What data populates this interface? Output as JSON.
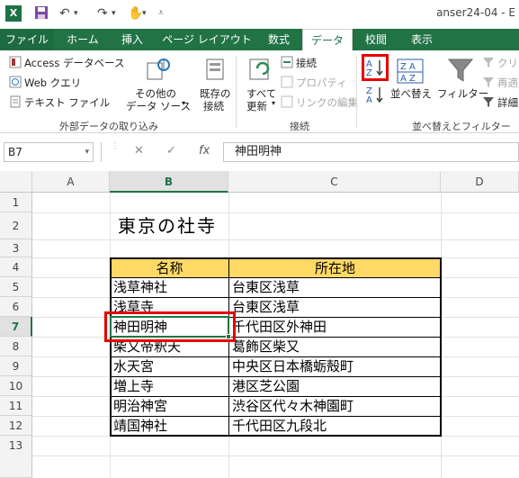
{
  "window": {
    "app_icon": "X",
    "title": "anser24-04 - E"
  },
  "ribbon_tabs": [
    "ファイル",
    "ホーム",
    "挿入",
    "ページ レイアウト",
    "数式",
    "データ",
    "校閲",
    "表示"
  ],
  "ribbon": {
    "external": {
      "access": "Access データベース",
      "web": "Web クエリ",
      "text": "テキスト ファイル",
      "other_line1": "その他の",
      "other_line2": "データ ソース",
      "existing_line1": "既存の",
      "existing_line2": "接続",
      "group_label": "外部データの取り込み"
    },
    "connections": {
      "refresh_line1": "すべて",
      "refresh_line2": "更新",
      "connections": "接続",
      "properties": "プロパティ",
      "edit_links": "リンクの編集",
      "group_label": "接続"
    },
    "sort_filter": {
      "sort_label": "並べ替え",
      "filter_label": "フィルター",
      "clear": "クリア",
      "reapply": "再適",
      "advanced": "詳細",
      "group_label": "並べ替えとフィルター"
    }
  },
  "formula_bar": {
    "name_box": "B7",
    "fx": "fx",
    "cancel": "✕",
    "enter": "✓",
    "formula": "神田明神"
  },
  "sheet": {
    "columns": [
      "A",
      "B",
      "C",
      "D"
    ],
    "rows": [
      "1",
      "2",
      "3",
      "4",
      "5",
      "6",
      "7",
      "8",
      "9",
      "10",
      "11",
      "12",
      "13"
    ],
    "title": "東京の社寺",
    "table_headers": [
      "名称",
      "所在地"
    ],
    "table_rows": [
      [
        "浅草神社",
        "台東区浅草"
      ],
      [
        "浅草寺",
        "台東区浅草"
      ],
      [
        "神田明神",
        "千代田区外神田"
      ],
      [
        "柴又帝釈天",
        "葛飾区柴又"
      ],
      [
        "水天宮",
        "中央区日本橋蛎殻町"
      ],
      [
        "増上寺",
        "港区芝公園"
      ],
      [
        "明治神宮",
        "渋谷区代々木神園町"
      ],
      [
        "靖国神社",
        "千代田区九段北"
      ]
    ],
    "active_cell": "B7"
  },
  "colors": {
    "excel_green": "#217346",
    "header_fill": "#ffd966",
    "highlight": "#e60000"
  }
}
